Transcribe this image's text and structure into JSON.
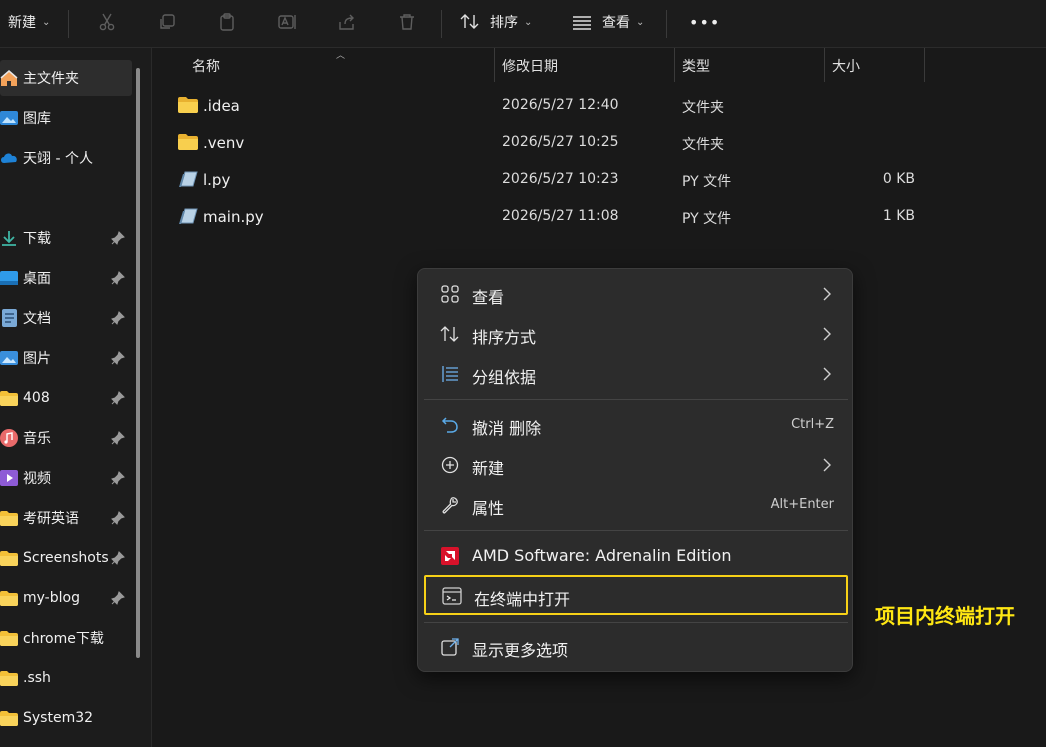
{
  "toolbar": {
    "new_label": "新建",
    "sort_label": "排序",
    "view_label": "查看",
    "more_label": "•••",
    "icons": [
      "cut-icon",
      "copy-icon",
      "paste-icon",
      "rename-icon",
      "share-icon",
      "delete-icon"
    ]
  },
  "sidebar": {
    "items": [
      {
        "label": "主文件夹",
        "icon": "home-icon",
        "pinned": false
      },
      {
        "label": "图库",
        "icon": "gallery-icon",
        "pinned": false
      },
      {
        "label": "天翊 - 个人",
        "icon": "onedrive-icon",
        "pinned": false
      },
      {
        "label": "下载",
        "icon": "download-icon",
        "pinned": true
      },
      {
        "label": "桌面",
        "icon": "desktop-icon",
        "pinned": true
      },
      {
        "label": "文档",
        "icon": "document-icon",
        "pinned": true
      },
      {
        "label": "图片",
        "icon": "pictures-icon",
        "pinned": true
      },
      {
        "label": "408",
        "icon": "folder-icon",
        "pinned": true
      },
      {
        "label": "音乐",
        "icon": "music-icon",
        "pinned": true
      },
      {
        "label": "视频",
        "icon": "video-icon",
        "pinned": true
      },
      {
        "label": "考研英语",
        "icon": "folder-icon",
        "pinned": true
      },
      {
        "label": "Screenshots",
        "icon": "folder-icon",
        "pinned": true
      },
      {
        "label": "my-blog",
        "icon": "folder-icon",
        "pinned": true
      },
      {
        "label": "chrome下载",
        "icon": "folder-icon",
        "pinned": false
      },
      {
        "label": ".ssh",
        "icon": "folder-icon",
        "pinned": false
      },
      {
        "label": "System32",
        "icon": "folder-icon",
        "pinned": false
      }
    ]
  },
  "columns": {
    "name": "名称",
    "modified": "修改日期",
    "type": "类型",
    "size": "大小"
  },
  "files": [
    {
      "name": ".idea",
      "modified": "2026/5/27 12:40",
      "type": "文件夹",
      "size": "",
      "icon": "folder-icon"
    },
    {
      "name": ".venv",
      "modified": "2026/5/27 10:25",
      "type": "文件夹",
      "size": "",
      "icon": "folder-icon"
    },
    {
      "name": "l.py",
      "modified": "2026/5/27 10:23",
      "type": "PY 文件",
      "size": "0 KB",
      "icon": "python-file-icon"
    },
    {
      "name": "main.py",
      "modified": "2026/5/27 11:08",
      "type": "PY 文件",
      "size": "1 KB",
      "icon": "python-file-icon"
    }
  ],
  "context_menu": {
    "view": "查看",
    "sort_by": "排序方式",
    "group_by": "分组依据",
    "undo_delete": "撤消 删除",
    "undo_shortcut": "Ctrl+Z",
    "new": "新建",
    "properties": "属性",
    "properties_shortcut": "Alt+Enter",
    "amd": "AMD Software: Adrenalin Edition",
    "open_terminal": "在终端中打开",
    "more_options": "显示更多选项"
  },
  "annotation": "项目内终端打开",
  "colors": {
    "highlight": "#f7d117",
    "annotation": "#ffe713",
    "folder": "#f2c038"
  }
}
